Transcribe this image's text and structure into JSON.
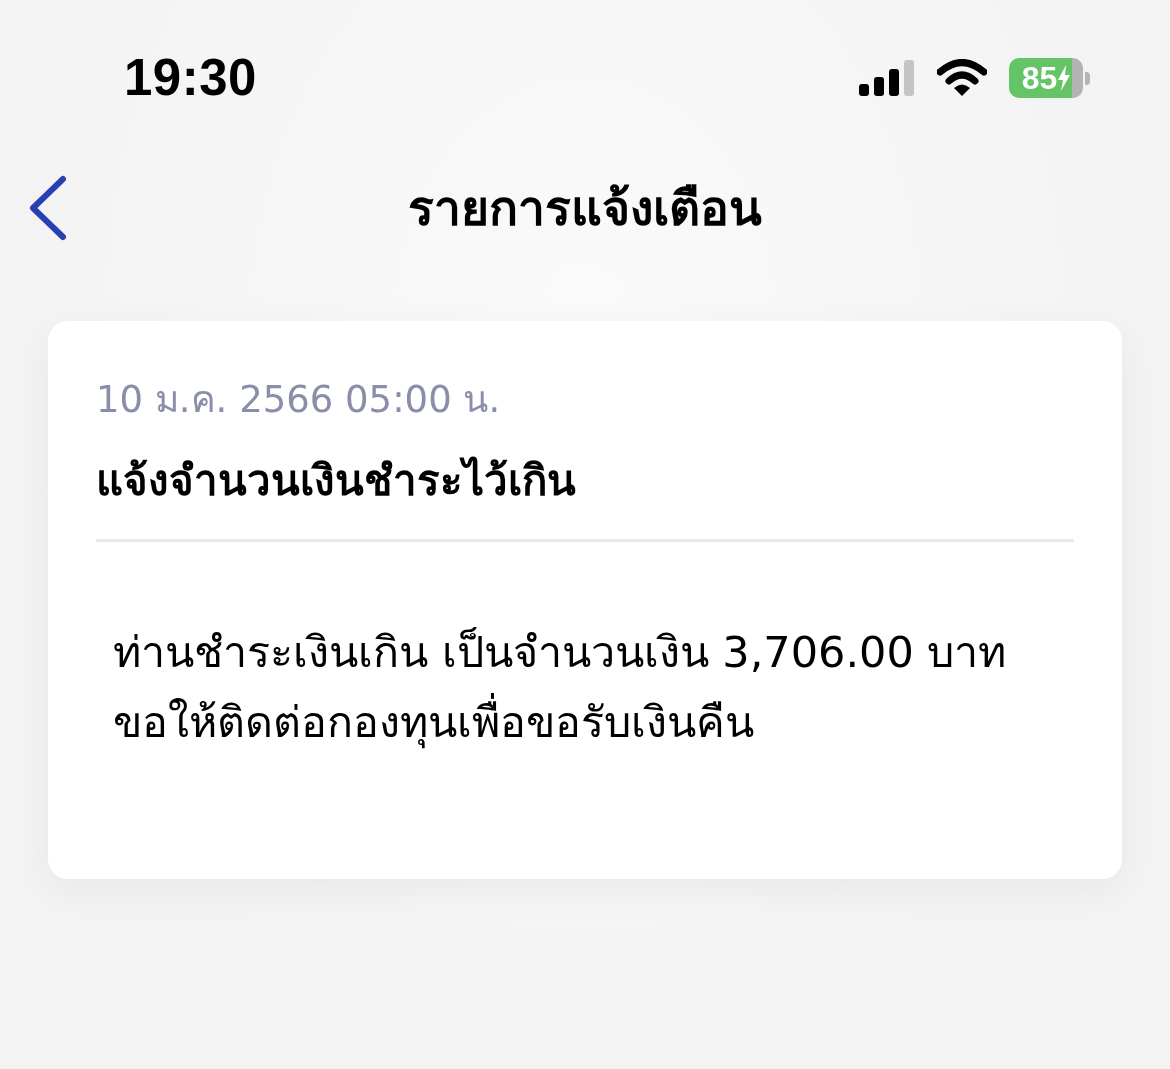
{
  "status_bar": {
    "time": "19:30",
    "battery": {
      "percent": "85",
      "charging": true
    }
  },
  "nav_bar": {
    "title": "รายการแจ้งเตือน"
  },
  "notifications": [
    {
      "date": "10 ม.ค. 2566 05:00 น.",
      "title": "แจ้งจำนวนเงินชำระไว้เกิน",
      "message": "ท่านชำระเงินเกิน เป็นจำนวนเงิน 3,706.00 บาท\nขอให้ติดต่อกองทุนเพื่อขอรับเงินคืน"
    }
  ]
}
